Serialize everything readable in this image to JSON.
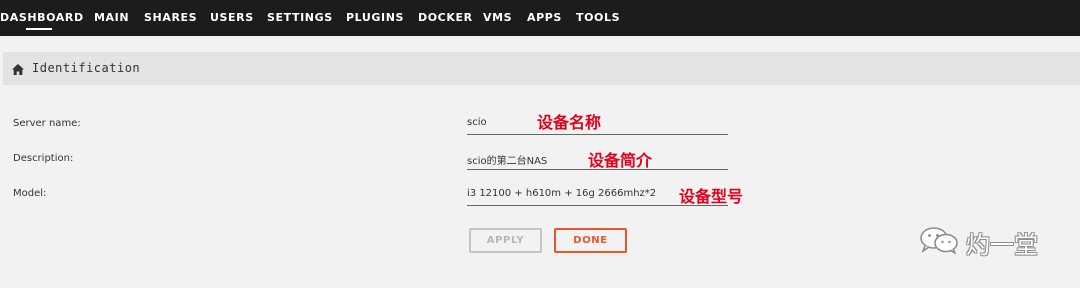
{
  "nav": {
    "items": [
      "DASHBOARD",
      "MAIN",
      "SHARES",
      "USERS",
      "SETTINGS",
      "PLUGINS",
      "DOCKER",
      "VMS",
      "APPS",
      "TOOLS"
    ],
    "active": "DASHBOARD"
  },
  "panel": {
    "icon": "home-icon",
    "title": "Identification"
  },
  "form": {
    "server_name": {
      "label": "Server name:",
      "value": "scio",
      "annotation": "设备名称"
    },
    "description": {
      "label": "Description:",
      "value": "scio的第二台NAS",
      "annotation": "设备简介"
    },
    "model": {
      "label": "Model:",
      "value": "i3 12100 + h610m + 16g 2666mhz*2",
      "annotation": "设备型号"
    }
  },
  "buttons": {
    "apply_label": "APPLY",
    "done_label": "DONE",
    "done_color": "#e8562a",
    "apply_color": "#b8b8b8"
  },
  "watermark": {
    "icon": "wechat-icon",
    "text": "灼一堂"
  },
  "colors": {
    "nav_bg": "#1c1c1c",
    "annotation": "#e5001c"
  }
}
